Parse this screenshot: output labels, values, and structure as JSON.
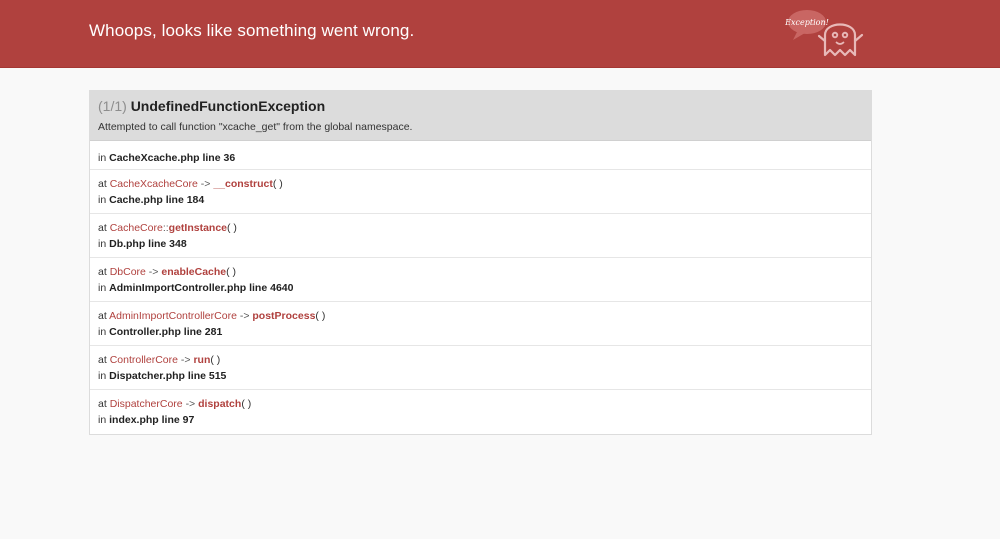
{
  "header": {
    "title": "Whoops, looks like something went wrong.",
    "logo_text": "Exception!"
  },
  "exception": {
    "count": "(1/1)",
    "name": "UndefinedFunctionException",
    "message": "Attempted to call function \"xcache_get\" from the global namespace."
  },
  "trace": {
    "origin": {
      "in": "in",
      "file_line": "CacheXcache.php line 36"
    },
    "frames": [
      {
        "at": "at",
        "class": "CacheXcacheCore",
        "call": "->",
        "method": "__construct",
        "args": "( )",
        "in": "in",
        "file_line": "Cache.php line 184"
      },
      {
        "at": "at",
        "class": "CacheCore",
        "call": "::",
        "method": "getInstance",
        "args": "( )",
        "in": "in",
        "file_line": "Db.php line 348"
      },
      {
        "at": "at",
        "class": "DbCore",
        "call": "->",
        "method": "enableCache",
        "args": "( )",
        "in": "in",
        "file_line": "AdminImportController.php line 4640"
      },
      {
        "at": "at",
        "class": "AdminImportControllerCore",
        "call": "->",
        "method": "postProcess",
        "args": "( )",
        "in": "in",
        "file_line": "Controller.php line 281"
      },
      {
        "at": "at",
        "class": "ControllerCore",
        "call": "->",
        "method": "run",
        "args": "( )",
        "in": "in",
        "file_line": "Dispatcher.php line 515"
      },
      {
        "at": "at",
        "class": "DispatcherCore",
        "call": "->",
        "method": "dispatch",
        "args": "( )",
        "in": "in",
        "file_line": "index.php line 97"
      }
    ]
  },
  "colors": {
    "header_bg": "#b0413e",
    "page_bg": "#f9f9f9",
    "exception_head_bg": "#dcdcdc",
    "link": "#b0413e"
  }
}
